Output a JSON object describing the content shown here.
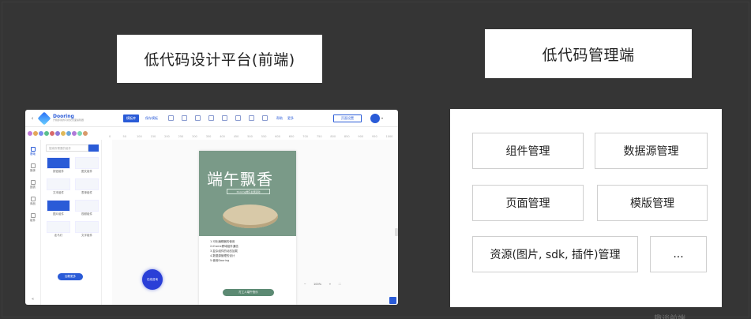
{
  "titles": {
    "frontend": "低代码设计平台(前端)",
    "management": "低代码管理端"
  },
  "editor": {
    "logo_name": "Dooring",
    "logo_sub": "开箱即用的可视化页面编辑器",
    "toolbar": {
      "primary": "模板库",
      "secondary": "保存模板",
      "help": "帮助",
      "more": "更多",
      "preview": "页面设置"
    },
    "sidebar": [
      "基础",
      "媒体",
      "图表",
      "商品",
      "组件"
    ],
    "search_placeholder": "搜索所需要的组件",
    "components": [
      "按钮组件",
      "图文组件",
      "文本组件",
      "表单组件",
      "图片组件",
      "视频组件",
      "走马灯",
      "文字组件"
    ],
    "load_more": "加载更多",
    "ruler_ticks": [
      "0",
      "50",
      "100",
      "150",
      "200",
      "250",
      "300",
      "350",
      "400",
      "450",
      "500",
      "550",
      "600",
      "650",
      "700",
      "750",
      "800",
      "850",
      "900",
      "950",
      "1000"
    ],
    "phone": {
      "hero_title": "端午飘香",
      "hero_sub": "Dooring端午主题活动",
      "list": [
        "1.可化编辑器的使用",
        "2.iframe跨域组件通信",
        "3.复杂组件的动态加载",
        "4.数据源管理的设计",
        "5.使用Dooring"
      ],
      "cta": "打工人端午快乐"
    },
    "zoom": "100%",
    "float_button": "在线咨询"
  },
  "management": {
    "items": [
      "组件管理",
      "数据源管理",
      "页面管理",
      "模版管理",
      "资源(图片, sdk, 插件)管理",
      "..."
    ]
  },
  "watermark": "趣谈前端",
  "colors": {
    "background": "#353535",
    "accent": "#2a5bd7",
    "hero_green": "#7a9a88"
  }
}
